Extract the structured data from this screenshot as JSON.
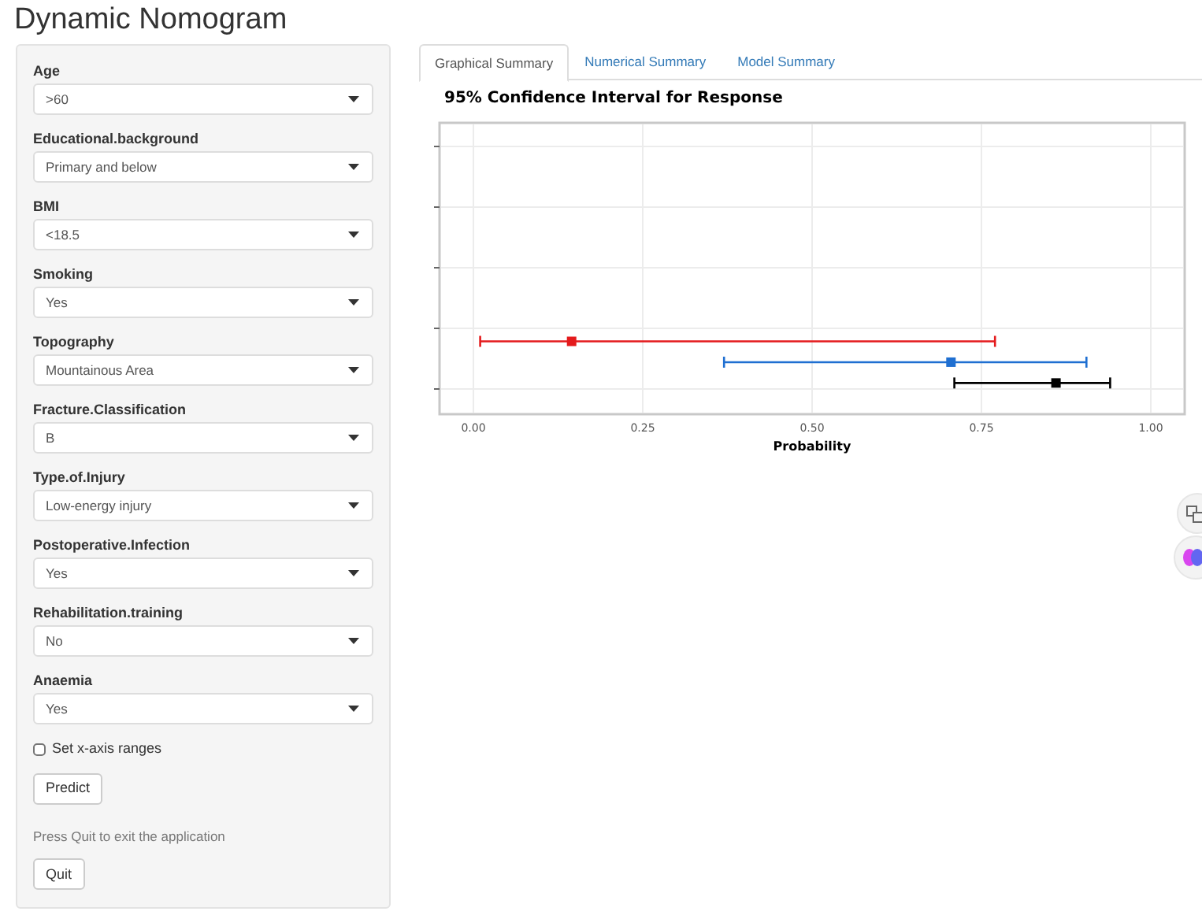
{
  "title": "Dynamic Nomogram",
  "inputs": [
    {
      "label": "Age",
      "value": ">60"
    },
    {
      "label": "Educational.background",
      "value": "Primary and below"
    },
    {
      "label": "BMI",
      "value": "<18.5"
    },
    {
      "label": "Smoking",
      "value": "Yes"
    },
    {
      "label": "Topography",
      "value": "Mountainous Area"
    },
    {
      "label": "Fracture.Classification",
      "value": "B"
    },
    {
      "label": "Type.of.Injury",
      "value": "Low-energy injury"
    },
    {
      "label": "Postoperative.Infection",
      "value": "Yes"
    },
    {
      "label": "Rehabilitation.training",
      "value": "No"
    },
    {
      "label": "Anaemia",
      "value": "Yes"
    }
  ],
  "x_axis_checkbox": {
    "label": "Set x-axis ranges",
    "checked": false
  },
  "predict_button": "Predict",
  "quit_hint": "Press Quit to exit the application",
  "quit_button": "Quit",
  "tabs": [
    {
      "label": "Graphical Summary",
      "selected": true
    },
    {
      "label": "Numerical Summary",
      "selected": false
    },
    {
      "label": "Model Summary",
      "selected": false
    }
  ],
  "chart_data": {
    "type": "scatter",
    "orientation": "horizontal",
    "grid": true,
    "categories": [
      null,
      null,
      null,
      null,
      null,
      null,
      null,
      null,
      null,
      null,
      null,
      null,
      null,
      null
    ],
    "title": "95% Confidence Interval for Response",
    "xlabel": "Probability",
    "xlim": [
      -0.05,
      1.05
    ],
    "xticks": [
      {
        "value": 0,
        "label": "0.00"
      },
      {
        "value": 0.25,
        "label": "0.25"
      },
      {
        "value": 0.5,
        "label": "0.50"
      },
      {
        "value": 0.75,
        "label": "0.75"
      },
      {
        "value": 1,
        "label": "1.00"
      }
    ],
    "series": [
      {
        "color": "#e41a1c",
        "values": [
          null,
          null,
          null,
          null,
          null,
          null,
          null,
          null,
          null,
          null,
          0.145,
          null,
          null,
          null
        ],
        "errors": [
          null,
          null,
          null,
          null,
          null,
          null,
          null,
          null,
          null,
          null,
          [
            0.01,
            0.77
          ],
          null,
          null,
          null
        ]
      },
      {
        "color": "#1f6fd1",
        "values": [
          null,
          null,
          null,
          null,
          null,
          null,
          null,
          null,
          null,
          null,
          null,
          0.705,
          null,
          null
        ],
        "errors": [
          null,
          null,
          null,
          null,
          null,
          null,
          null,
          null,
          null,
          null,
          null,
          [
            0.37,
            0.905
          ],
          null,
          null
        ]
      },
      {
        "color": "#000000",
        "values": [
          null,
          null,
          null,
          null,
          null,
          null,
          null,
          null,
          null,
          null,
          null,
          null,
          0.86,
          null
        ],
        "errors": [
          null,
          null,
          null,
          null,
          null,
          null,
          null,
          null,
          null,
          null,
          null,
          null,
          [
            0.71,
            0.94
          ],
          null
        ]
      }
    ]
  }
}
